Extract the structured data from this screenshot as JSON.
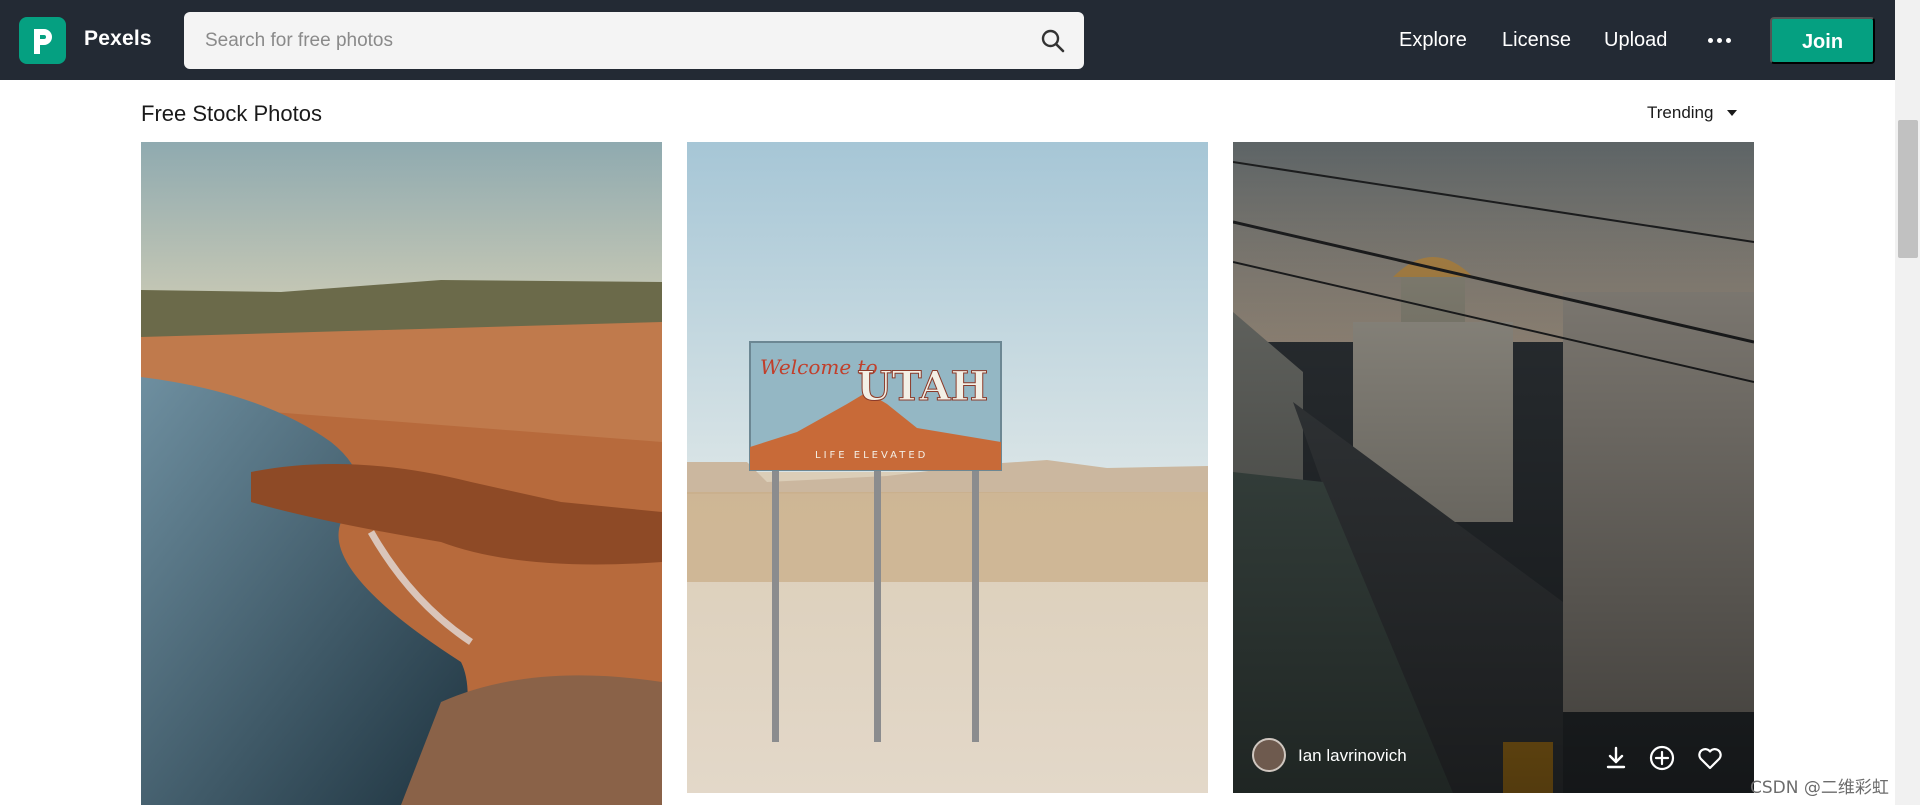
{
  "header": {
    "brand": "Pexels",
    "search_placeholder": "Search for free photos",
    "nav": {
      "explore": "Explore",
      "license": "License",
      "upload": "Upload"
    },
    "more_icon": "more-dots-icon",
    "join": "Join"
  },
  "colors": {
    "topbar": "#232a34",
    "brand_green": "#05a081"
  },
  "section": {
    "title": "Free Stock Photos",
    "sort": "Trending"
  },
  "photos": [
    {
      "name": "coastal-rock-shore"
    },
    {
      "name": "welcome-to-utah-billboard",
      "sign_script": "Welcome to",
      "sign_title": "UTAH",
      "sign_tagline": "LIFE ELEVATED"
    },
    {
      "name": "city-street-cathedral",
      "author": "Ian lavrinovich"
    }
  ],
  "actions": {
    "download": "download-icon",
    "collect": "plus-circle-icon",
    "like": "heart-icon"
  },
  "watermark": "CSDN @二维彩虹"
}
